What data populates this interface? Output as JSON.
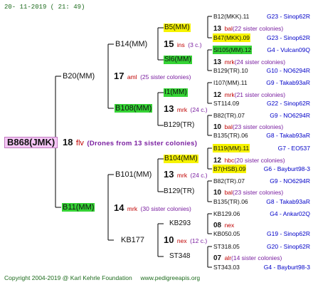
{
  "header": {
    "datetime": "20- 11-2019 ( 21: 49)"
  },
  "footer": {
    "copyright": "Copyright 2004-2019 @ Karl Kehrle Foundation",
    "site": "www.pedigreeapis.org"
  },
  "root": {
    "id": "B868(JMK)",
    "count": "18",
    "code": "flv",
    "note": "(Drones from 13 sister colonies)"
  },
  "gen1": [
    {
      "id": "B20(MM)"
    },
    {
      "id": "B11(MM)",
      "count": "14",
      "code": "mrk",
      "note": "(30 sister colonies)"
    }
  ],
  "gen2": [
    {
      "id": "B14(MM)",
      "count": "17",
      "code": "aml",
      "note": "(25 sister colonies)"
    },
    {
      "id": "B108(MM)"
    },
    {
      "id": "B101(MM)"
    },
    {
      "id": "KB177"
    }
  ],
  "gen3": [
    {
      "id": "B5(MM)"
    },
    {
      "id": "15",
      "code": "ins",
      "note": "(3 c.)"
    },
    {
      "id": "Sl6(MM)"
    },
    {
      "id": "I1(MM)"
    },
    {
      "id": "13",
      "code": "mrk",
      "note": "(24 c.)"
    },
    {
      "id": "B129(TR)"
    },
    {
      "id": "B104(MM)"
    },
    {
      "id": "13",
      "code": "mrk",
      "note": "(24 c.)"
    },
    {
      "id": "B129(TR)"
    },
    {
      "id": "KB293"
    },
    {
      "id": "10",
      "code": "nex",
      "note": "(12 c.)"
    },
    {
      "id": "ST348"
    }
  ],
  "gen4": [
    {
      "id": "B12(MKK).11",
      "info": "G23 - Sinop62R"
    },
    {
      "count": "13",
      "code": "bal",
      "note": "(22 sister colonies)"
    },
    {
      "id": "B47(MKK).09",
      "info": "G23 - Sinop62R"
    },
    {
      "id": "Sl105(MM).12",
      "info": "G4 - Vulcan09Q"
    },
    {
      "count": "13",
      "code": "mrk",
      "note": "(24 sister colonies)"
    },
    {
      "id": "B129(TR).10",
      "info": "G10 - NO6294R"
    },
    {
      "id": "I107(MM).11",
      "info": "G9 - Takab93aR"
    },
    {
      "count": "12",
      "code": "mrk",
      "note": "(21 sister colonies)"
    },
    {
      "id": "ST114.09",
      "info": "G22 - Sinop62R"
    },
    {
      "id": "B82(TR).07",
      "info": "G9 - NO6294R"
    },
    {
      "count": "10",
      "code": "bal",
      "note": "(23 sister colonies)"
    },
    {
      "id": "B135(TR).06",
      "info": "G8 - Takab93aR"
    },
    {
      "id": "B119(MM).11",
      "info": "G7 - EO537"
    },
    {
      "count": "12",
      "code": "hbc",
      "note": "(20 sister colonies)"
    },
    {
      "id": "B7(HSB).09",
      "info": "G6 - Bayburt98-3"
    },
    {
      "id": "B82(TR).07",
      "info": "G9 - NO6294R"
    },
    {
      "count": "10",
      "code": "bal",
      "note": "(23 sister colonies)"
    },
    {
      "id": "B135(TR).06",
      "info": "G8 - Takab93aR"
    },
    {
      "id": "KB129.06",
      "info": "G4 - Ankar02Q"
    },
    {
      "count": "08",
      "code": "nex",
      "note": ""
    },
    {
      "id": "KB050.05",
      "info": "G19 - Sinop62R"
    },
    {
      "id": "ST318.05",
      "info": "G20 - Sinop62R"
    },
    {
      "count": "07",
      "code": "alr",
      "note": "(14 sister colonies)"
    },
    {
      "id": "ST343.03",
      "info": "G4 - Bayburt98-3"
    }
  ]
}
